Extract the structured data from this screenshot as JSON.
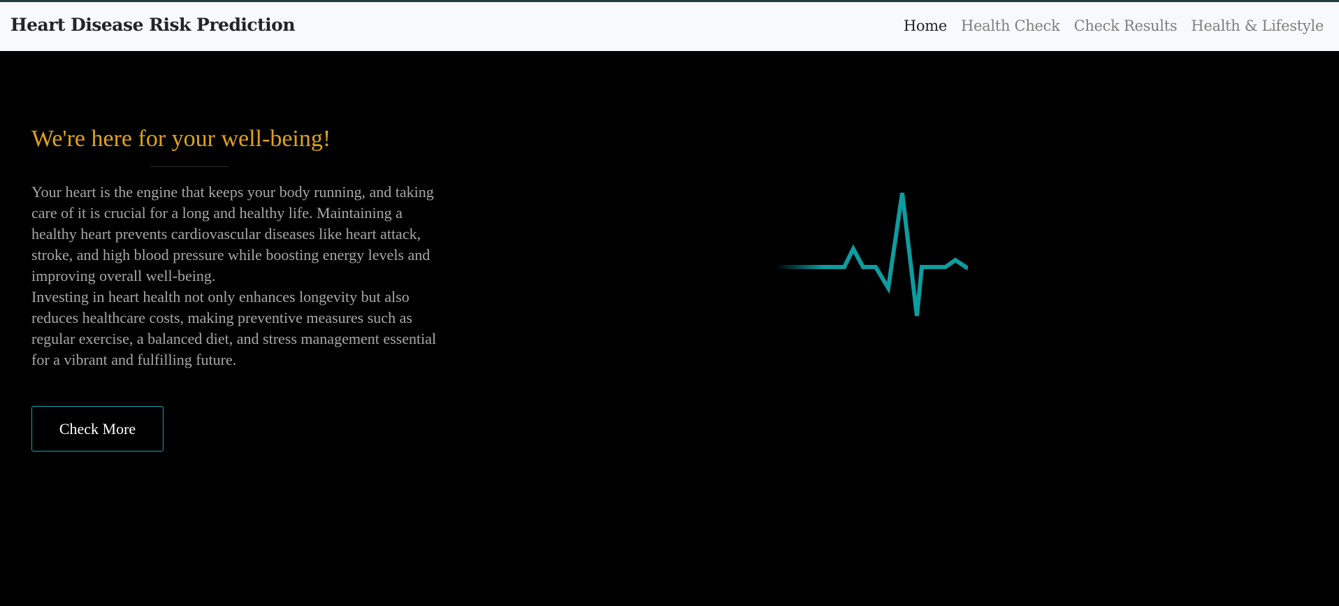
{
  "navbar": {
    "brand": "Heart Disease Risk Prediction",
    "links": [
      {
        "label": "Home",
        "active": true
      },
      {
        "label": "Health Check",
        "active": false
      },
      {
        "label": "Check Results",
        "active": false
      },
      {
        "label": "Health & Lifestyle",
        "active": false
      }
    ]
  },
  "hero": {
    "title": "We're here for your well-being!",
    "paragraph1": "Your heart is the engine that keeps your body running, and taking care of it is crucial for a long and healthy life. Maintaining a healthy heart prevents cardiovascular diseases like heart attack, stroke, and high blood pressure while boosting energy levels and improving overall well-being.",
    "paragraph2": "Investing in heart health not only enhances longevity but also reduces healthcare costs, making preventive measures such as regular exercise, a balanced diet, and stress management essential for a vibrant and fulfilling future.",
    "button_label": "Check More",
    "accent_color": "#e0a21c",
    "ekg_icon": "heartbeat-line-icon",
    "ekg_color": "#0d9c9f"
  }
}
